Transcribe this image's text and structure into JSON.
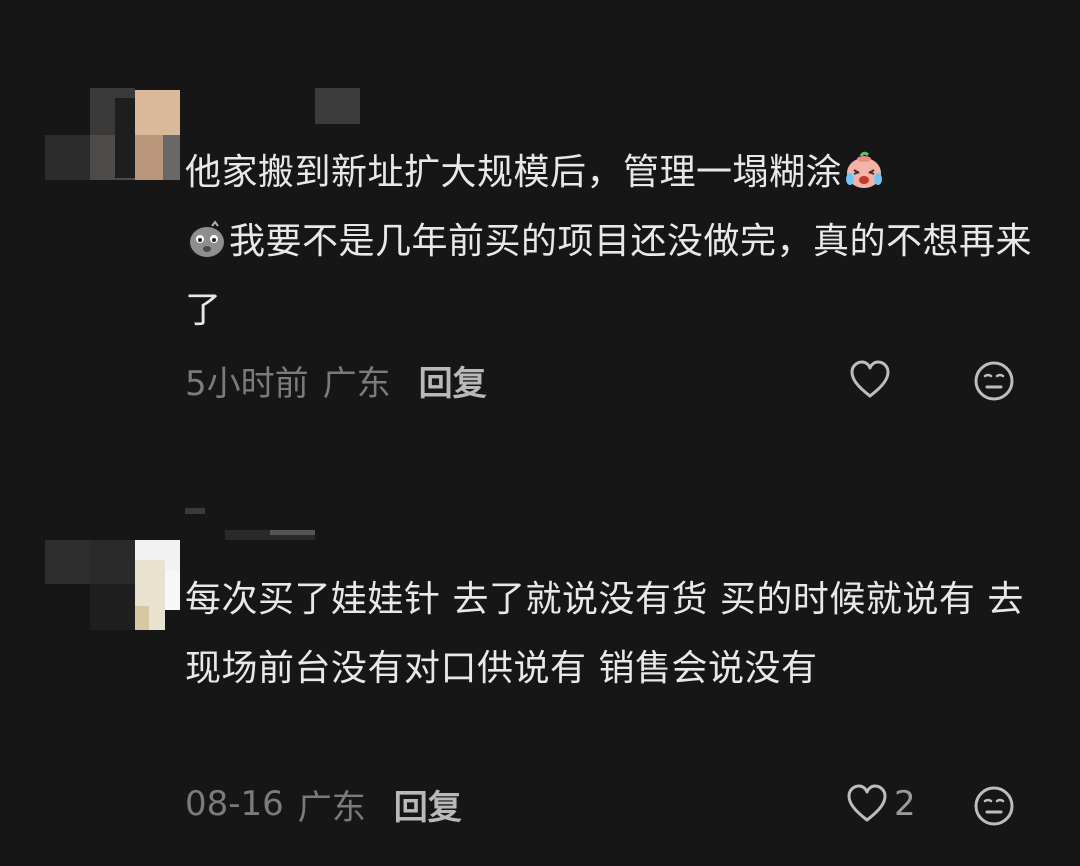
{
  "comments": [
    {
      "text_before_emoji1": "他家搬到新址扩大规模后，管理一塌糊涂",
      "emoji1": "crying-laughing-emoji",
      "emoji2": "speechless-emoji",
      "text_after_emoji2": "我要不是几年前买的项目还没做完，真的不想再来了",
      "time": "5小时前",
      "location": "广东",
      "reply_label": "回复",
      "like_count": "",
      "like_icon": "heart-outline-icon",
      "reaction_icon": "neutral-face-icon"
    },
    {
      "text": "每次买了娃娃针 去了就说没有货 买的时候就说有  去现场前台没有对口供说有 销售会说没有",
      "time": "08-16",
      "location": "广东",
      "reply_label": "回复",
      "like_count": "2",
      "like_icon": "heart-outline-icon",
      "reaction_icon": "neutral-face-icon"
    }
  ],
  "colors": {
    "background": "#161616",
    "text": "#e8e8e8",
    "meta": "#7b7b7b",
    "reply": "#b9b9b9",
    "icon": "#bdbdbd"
  }
}
